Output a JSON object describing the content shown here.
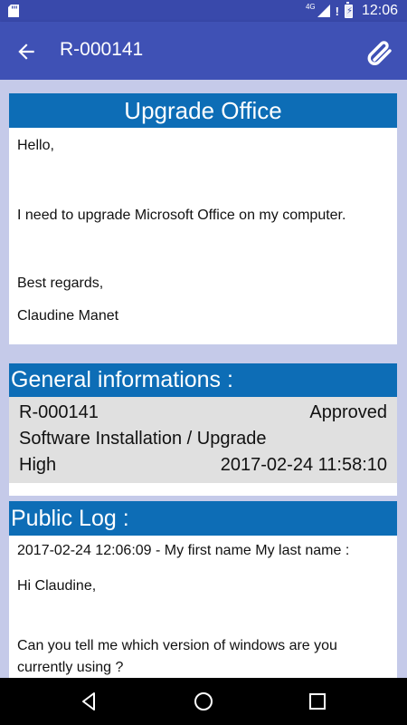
{
  "status_bar": {
    "network": "4G",
    "time": "12:06"
  },
  "app_bar": {
    "title": "R-000141",
    "back_icon": "arrow-back-icon",
    "attach_icon": "paperclip-icon"
  },
  "request": {
    "title": "Upgrade Office",
    "body": {
      "greeting": "Hello,",
      "text": "I need to upgrade Microsoft Office on my computer.",
      "closing": "Best regards,",
      "signature": "Claudine Manet"
    }
  },
  "general": {
    "heading": "General informations :",
    "id": "R-000141",
    "status": "Approved",
    "category": "Software Installation / Upgrade",
    "priority": "High",
    "date": "2017-02-24 11:58:10"
  },
  "public_log": {
    "heading": "Public Log :",
    "entry_header": "2017-02-24 12:06:09 - My first name My last name :",
    "greeting": "Hi Claudine,",
    "line1": "Can you tell me which version of windows are you",
    "line2": "currently using ?"
  },
  "nav": {
    "back_icon": "triangle-back-icon",
    "home_icon": "circle-home-icon",
    "recents_icon": "square-recents-icon"
  },
  "colors": {
    "status_bar": "#3949ab",
    "app_bar": "#3f51b5",
    "header": "#0d6db6",
    "background": "#c5cae9",
    "info_bg": "#e0e0e0"
  }
}
